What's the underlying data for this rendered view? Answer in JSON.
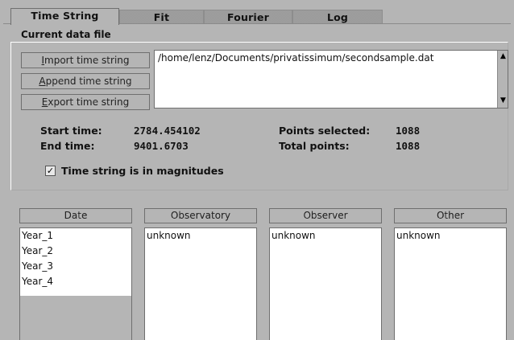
{
  "tabs": [
    {
      "label": "Time String",
      "active": true
    },
    {
      "label": "Fit",
      "active": false
    },
    {
      "label": "Fourier",
      "active": false
    },
    {
      "label": "Log",
      "active": false
    }
  ],
  "current_file": {
    "group_label": "Current data file",
    "path": "/home/lenz/Documents/privatissimum/secondsample.dat"
  },
  "buttons": {
    "import": {
      "mnemonic": "I",
      "rest": "mport time string"
    },
    "append": {
      "mnemonic": "A",
      "rest": "ppend time string"
    },
    "export": {
      "mnemonic": "E",
      "rest": "xport time string"
    }
  },
  "stats": {
    "start_time_label": "Start time:",
    "start_time_value": "2784.454102",
    "end_time_label": "End time:",
    "end_time_value": "9401.6703",
    "points_selected_label": "Points selected:",
    "points_selected_value": "1088",
    "total_points_label": "Total points:",
    "total_points_value": "1088"
  },
  "magnitudes": {
    "label": "Time string is in magnitudes",
    "checked": true,
    "check_glyph": "✓"
  },
  "lists": [
    {
      "header": "Date",
      "items": [
        "Year_1",
        "Year_2",
        "Year_3",
        "Year_4"
      ]
    },
    {
      "header": "Observatory",
      "items": [
        "unknown"
      ]
    },
    {
      "header": "Observer",
      "items": [
        "unknown"
      ]
    },
    {
      "header": "Other",
      "items": [
        "unknown"
      ]
    }
  ],
  "scroll": {
    "up_glyph": "▲",
    "down_glyph": "▼"
  }
}
